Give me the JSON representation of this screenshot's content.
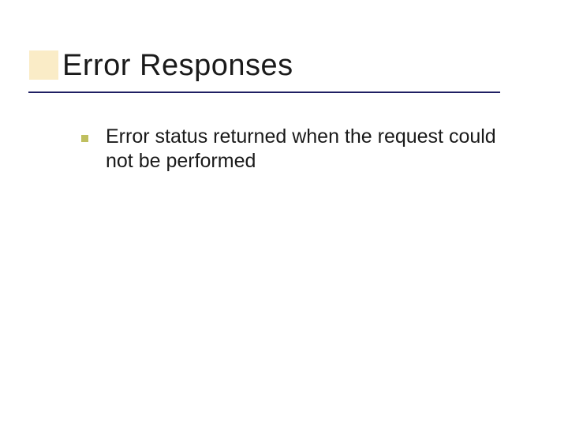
{
  "slide": {
    "title": "Error Responses",
    "bullets": [
      {
        "text": "Error status returned when the request could not be performed"
      }
    ]
  },
  "colors": {
    "accent_square": "#faecc7",
    "underline": "#1f1f63",
    "bullet_marker": "#bfbf5f"
  }
}
